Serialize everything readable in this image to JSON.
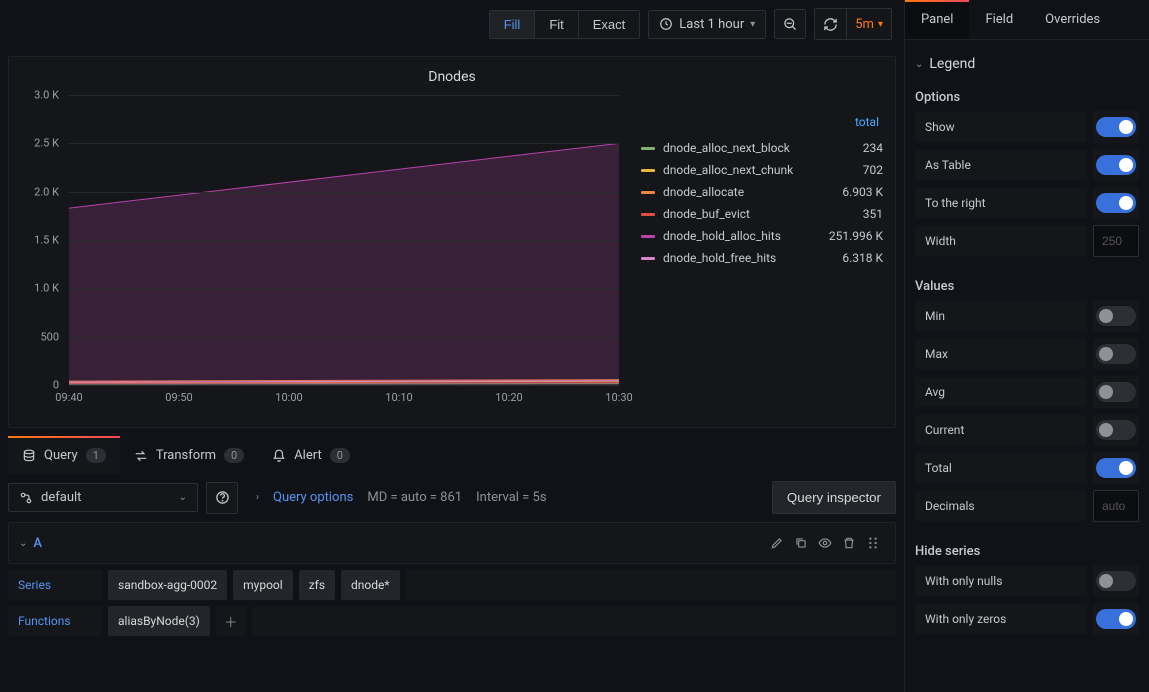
{
  "toolbar": {
    "scale_modes": [
      "Fill",
      "Fit",
      "Exact"
    ],
    "scale_active": 0,
    "time_range": "Last 1 hour",
    "refresh_interval": "5m"
  },
  "panel": {
    "title": "Dnodes"
  },
  "chart_data": {
    "type": "line",
    "ylim": [
      0,
      3000
    ],
    "yticks": [
      0,
      500,
      1000,
      1500,
      2000,
      2500,
      3000
    ],
    "ytick_labels": [
      "0",
      "500",
      "1.0 K",
      "1.5 K",
      "2.0 K",
      "2.5 K",
      "3.0 K"
    ],
    "xticks": [
      "09:40",
      "09:50",
      "10:00",
      "10:10",
      "10:20",
      "10:30"
    ],
    "series": [
      {
        "name": "dnode_alloc_next_block",
        "color": "#7eb26d",
        "y0": 10,
        "y1": 14
      },
      {
        "name": "dnode_alloc_next_chunk",
        "color": "#eab839",
        "y0": 25,
        "y1": 38
      },
      {
        "name": "dnode_allocate",
        "color": "#ef843c",
        "y0": 40,
        "y1": 55
      },
      {
        "name": "dnode_buf_evict",
        "color": "#e24d42",
        "y0": 18,
        "y1": 24
      },
      {
        "name": "dnode_hold_alloc_hits",
        "color": "#ba43a9",
        "y0": 1830,
        "y1": 2500
      },
      {
        "name": "dnode_hold_free_hits",
        "color": "#d683ce",
        "y0": 30,
        "y1": 45
      }
    ]
  },
  "legend": {
    "header": "total",
    "rows": [
      {
        "name": "dnode_alloc_next_block",
        "color": "#7eb26d",
        "value": "234"
      },
      {
        "name": "dnode_alloc_next_chunk",
        "color": "#eab839",
        "value": "702"
      },
      {
        "name": "dnode_allocate",
        "color": "#ef843c",
        "value": "6.903 K"
      },
      {
        "name": "dnode_buf_evict",
        "color": "#e24d42",
        "value": "351"
      },
      {
        "name": "dnode_hold_alloc_hits",
        "color": "#ba43a9",
        "value": "251.996 K"
      },
      {
        "name": "dnode_hold_free_hits",
        "color": "#d683ce",
        "value": "6.318 K"
      }
    ]
  },
  "bottom_tabs": {
    "query": {
      "label": "Query",
      "count": "1"
    },
    "transform": {
      "label": "Transform",
      "count": "0"
    },
    "alert": {
      "label": "Alert",
      "count": "0"
    }
  },
  "query_editor": {
    "datasource": "default",
    "options_label": "Query options",
    "md_text": "MD = auto = 861",
    "interval_text": "Interval = 5s",
    "inspector_label": "Query inspector",
    "row_letter": "A",
    "series_label": "Series",
    "series_segments": [
      "sandbox-agg-0002",
      "mypool",
      "zfs",
      "dnode*"
    ],
    "functions_label": "Functions",
    "functions_segments": [
      "aliasByNode(3)"
    ]
  },
  "side": {
    "tabs": [
      "Panel",
      "Field",
      "Overrides"
    ],
    "legend_section": "Legend",
    "options_label": "Options",
    "options": {
      "show": {
        "label": "Show",
        "on": true
      },
      "as_table": {
        "label": "As Table",
        "on": true
      },
      "to_right": {
        "label": "To the right",
        "on": true
      },
      "width": {
        "label": "Width",
        "placeholder": "250"
      }
    },
    "values_label": "Values",
    "values": {
      "min": {
        "label": "Min",
        "on": false
      },
      "max": {
        "label": "Max",
        "on": false
      },
      "avg": {
        "label": "Avg",
        "on": false
      },
      "current": {
        "label": "Current",
        "on": false
      },
      "total": {
        "label": "Total",
        "on": true
      },
      "decimals": {
        "label": "Decimals",
        "placeholder": "auto"
      }
    },
    "hide_label": "Hide series",
    "hide": {
      "nulls": {
        "label": "With only nulls",
        "on": false
      },
      "zeros": {
        "label": "With only zeros",
        "on": true
      }
    }
  }
}
